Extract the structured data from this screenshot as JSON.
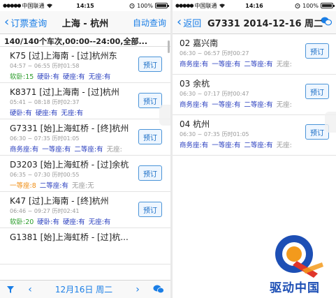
{
  "status": {
    "carrier": "中国联通",
    "battery": "100%",
    "left_time": "14:15",
    "right_time": "14:16"
  },
  "left": {
    "nav": {
      "back": "订票查询",
      "title": "上海 - 杭州",
      "right": "自动查询"
    },
    "filter": "140/140个车次,00:00--24:00,全部...",
    "trains": [
      {
        "name": "K75 [过]上海南 - [过]杭州东",
        "times": "04:57 ~ 06:55 历时01:58",
        "seats": [
          {
            "label": "软卧:15",
            "color": "green"
          },
          {
            "label": "硬卧:有",
            "color": "blue"
          },
          {
            "label": "硬座:有",
            "color": "blue"
          },
          {
            "label": "无座:有",
            "color": "blue"
          }
        ]
      },
      {
        "name": "K8371 [过]上海南 - [过]杭州",
        "times": "05:41 ~ 08:18 历时02:37",
        "seats": [
          {
            "label": "硬卧:有",
            "color": "blue"
          },
          {
            "label": "硬座:有",
            "color": "blue"
          },
          {
            "label": "无座:有",
            "color": "blue"
          }
        ]
      },
      {
        "name": "G7331 [始]上海虹桥 - [终]杭州",
        "times": "06:30 ~ 07:35 历时01:05",
        "seats": [
          {
            "label": "商务座:有",
            "color": "blue"
          },
          {
            "label": "一等座:有",
            "color": "blue"
          },
          {
            "label": "二等座:有",
            "color": "blue"
          },
          {
            "label": "无座:",
            "color": "gray"
          }
        ]
      },
      {
        "name": "D3203 [始]上海虹桥 - [过]余杭",
        "times": "06:35 ~ 07:30 历时00:55",
        "seats": [
          {
            "label": "一等座:8",
            "color": "orange"
          },
          {
            "label": "二等座:有",
            "color": "blue"
          },
          {
            "label": "无座:无",
            "color": "gray"
          }
        ]
      },
      {
        "name": "K47 [过]上海南 - [终]杭州",
        "times": "06:46 ~ 09:27 历时02:41",
        "seats": [
          {
            "label": "软卧:20",
            "color": "green"
          },
          {
            "label": "硬卧:有",
            "color": "blue"
          },
          {
            "label": "硬座:有",
            "color": "blue"
          },
          {
            "label": "无座:有",
            "color": "blue"
          }
        ]
      },
      {
        "name": "G1381 [始]上海虹桥 - [过]杭...",
        "times": "",
        "seats": []
      }
    ],
    "book_label": "预订",
    "bottom": {
      "date": "12月16日 周二",
      "prev": "‹",
      "next": "›"
    }
  },
  "right": {
    "nav": {
      "back": "返回",
      "title": "G7331 2014-12-16 周二"
    },
    "stations": [
      {
        "name": "02 嘉兴南",
        "times": "06:30 ~ 06:57 历时00:27",
        "seats": [
          {
            "label": "商务座:有",
            "color": "blue"
          },
          {
            "label": "一等座:有",
            "color": "blue"
          },
          {
            "label": "二等座:有",
            "color": "blue"
          },
          {
            "label": "无座:",
            "color": "gray"
          }
        ]
      },
      {
        "name": "03 余杭",
        "times": "06:30 ~ 07:17 历时00:47",
        "seats": [
          {
            "label": "商务座:有",
            "color": "blue"
          },
          {
            "label": "一等座:有",
            "color": "blue"
          },
          {
            "label": "二等座:有",
            "color": "blue"
          },
          {
            "label": "无座:",
            "color": "gray"
          }
        ]
      },
      {
        "name": "04 杭州",
        "times": "06:30 ~ 07:35 历时01:05",
        "seats": [
          {
            "label": "商务座:有",
            "color": "blue"
          },
          {
            "label": "一等座:有",
            "color": "blue"
          },
          {
            "label": "二等座:有",
            "color": "blue"
          },
          {
            "label": "无座:",
            "color": "gray"
          }
        ]
      }
    ],
    "book_label": "预订"
  },
  "watermark": {
    "text": "驱动中国"
  },
  "colors": {
    "accent": "#1a7ee6",
    "seat_blue": "#2a3fbf",
    "seat_green": "#2b9c2b",
    "seat_orange": "#f08c10"
  }
}
